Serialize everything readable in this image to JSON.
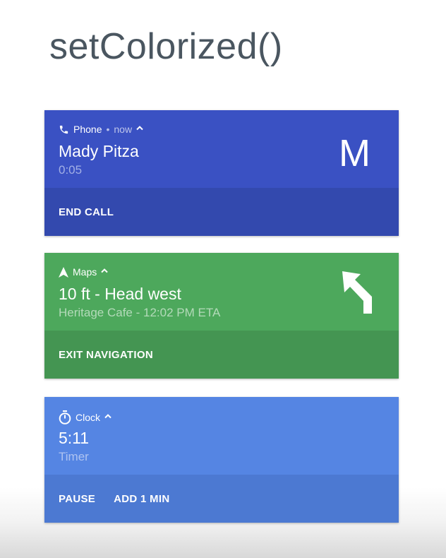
{
  "slide": {
    "title": "setColorized()"
  },
  "notifications": [
    {
      "app_name": "Phone",
      "separator": "•",
      "time": "now",
      "app_icon": "phone-icon",
      "title": "Mady Pitza",
      "subtitle": "0:05",
      "monogram": "M",
      "color": "#3a51c3",
      "action_color": "#3349ae",
      "actions": [
        "END CALL"
      ]
    },
    {
      "app_name": "Maps",
      "app_icon": "navigation-arrow-icon",
      "title": "10 ft - Head west",
      "subtitle": "Heritage Cafe - 12:02 PM ETA",
      "large_icon": "turn-left-arrow-icon",
      "color": "#4da85c",
      "action_color": "#449552",
      "actions": [
        "EXIT NAVIGATION"
      ]
    },
    {
      "app_name": "Clock",
      "app_icon": "timer-icon",
      "title": "5:11",
      "subtitle": "Timer",
      "color": "#5585e3",
      "action_color": "#4c79d2",
      "actions": [
        "PAUSE",
        "ADD 1 MIN"
      ]
    }
  ],
  "icons": {
    "expand": "chevron-up-icon"
  }
}
